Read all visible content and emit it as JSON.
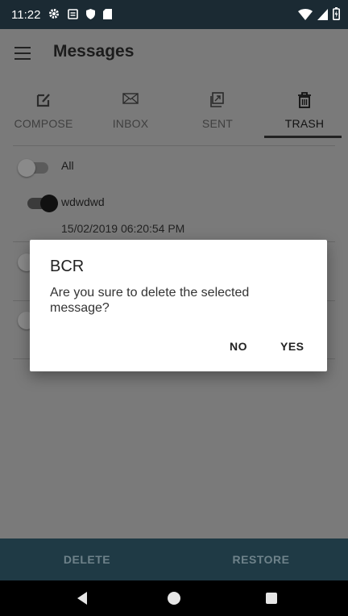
{
  "status_bar": {
    "time": "11:22",
    "left_icons": [
      "gear-icon",
      "notification-icon",
      "shield-icon",
      "sd-card-icon"
    ],
    "right_icons": [
      "wifi-icon",
      "cellular-icon",
      "battery-icon"
    ]
  },
  "app_bar": {
    "title": "Messages",
    "menu_icon": "hamburger-menu-icon"
  },
  "tabs": [
    {
      "label": "COMPOSE",
      "icon": "compose-icon",
      "active": false
    },
    {
      "label": "INBOX",
      "icon": "envelope-icon",
      "active": false
    },
    {
      "label": "SENT",
      "icon": "sent-icon",
      "active": false
    },
    {
      "label": "TRASH",
      "icon": "trash-icon",
      "active": true
    }
  ],
  "list": {
    "select_all_label": "All",
    "select_all_checked": false,
    "items": [
      {
        "sender": "wdwdwd",
        "timestamp": "15/02/2019 06:20:54 PM",
        "checked": true
      }
    ]
  },
  "dialog": {
    "title": "BCR",
    "message": "Are you sure to delete the selected message?",
    "negative_label": "NO",
    "positive_label": "YES"
  },
  "bottom_bar": {
    "delete_label": "DELETE",
    "restore_label": "RESTORE"
  },
  "colors": {
    "status_bar": "#1b2a33",
    "bottom_bar": "#1f3a45",
    "scrim_background": "#7a7a7a",
    "dialog_background": "#ffffff"
  }
}
